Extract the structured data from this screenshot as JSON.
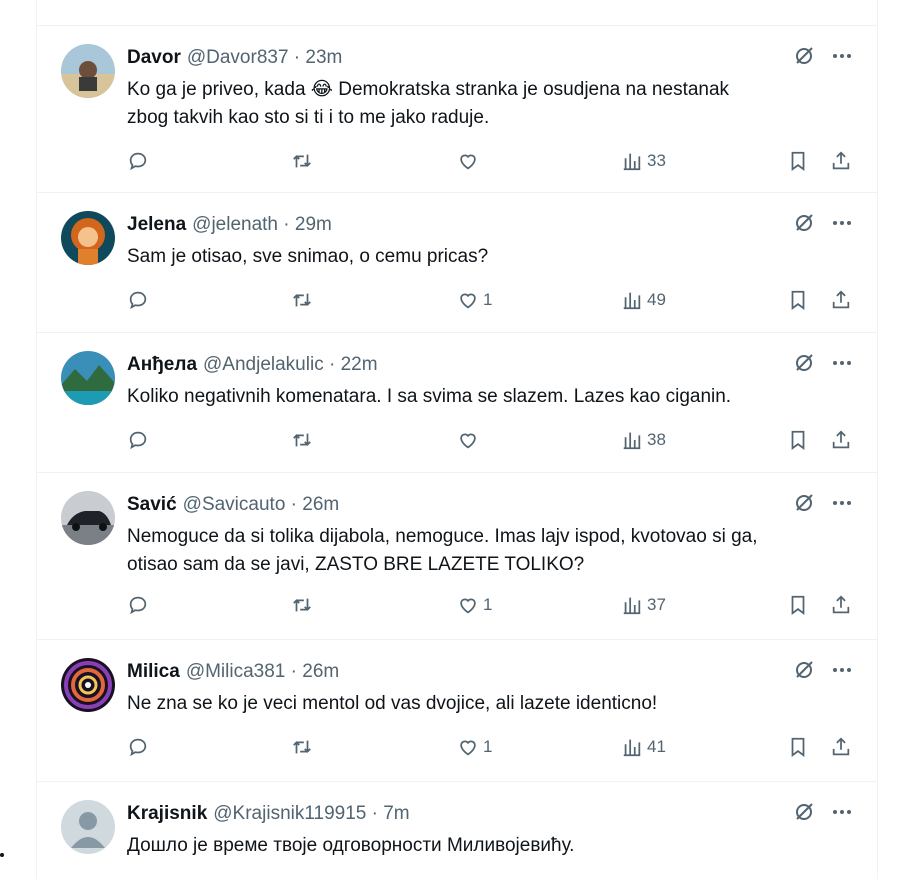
{
  "tweets": [
    {
      "name": "Davor",
      "handle": "@Davor837",
      "time": "23m",
      "lines": [
        "Ko ga je priveo, kada 😂 Demokratska stranka je osudjena na nestanak",
        "zbog takvih kao sto si ti i to me jako raduje."
      ],
      "likes": "",
      "views": "33"
    },
    {
      "name": "Jelena",
      "handle": "@jelenath",
      "time": "29m",
      "lines": [
        "Sam je otisao, sve snimao, o cemu pricas?"
      ],
      "likes": "1",
      "views": "49"
    },
    {
      "name": "Анђела",
      "handle": "@Andjelakulic",
      "time": "22m",
      "lines": [
        "Koliko negativnih komenatara. I sa svima se slazem. Lazes kao ciganin."
      ],
      "likes": "",
      "views": "38"
    },
    {
      "name": "Savić",
      "handle": "@Savicauto",
      "time": "26m",
      "lines": [
        "Nemoguce da si tolika dijabola, nemoguce. Imas lajv ispod, kvotovao si ga,",
        "otisao sam da se javi, ZASTO BRE LAZETE TOLIKO?"
      ],
      "likes": "1",
      "views": "37"
    },
    {
      "name": "Milica",
      "handle": "@Milica381",
      "time": "26m",
      "lines": [
        "Ne zna se ko je veci mentol od vas dvojice, ali lazete identicno!"
      ],
      "likes": "1",
      "views": "41"
    },
    {
      "name": "Krajisnik",
      "handle": "@Krajisnik119915",
      "time": "7m",
      "lines": [
        "Дошло је време твоје одговорности Миливојевићу."
      ],
      "likes": "",
      "views": ""
    }
  ],
  "colors": {
    "text": "#0f1419",
    "muted": "#536471",
    "border": "#eff3f4"
  },
  "icons": [
    "reply-icon",
    "retweet-icon",
    "like-icon",
    "views-icon",
    "bookmark-icon",
    "share-icon",
    "grok-icon",
    "more-icon"
  ]
}
